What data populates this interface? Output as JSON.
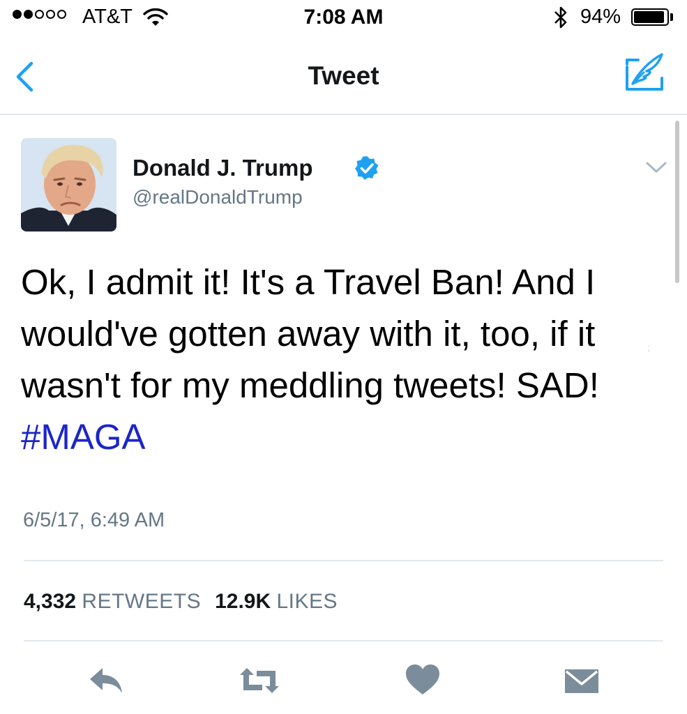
{
  "status_bar": {
    "carrier": "AT&T",
    "time": "7:08 AM",
    "battery_percent": "94%",
    "battery_level": 0.94,
    "signal_strength": 2,
    "signal_total": 5
  },
  "nav": {
    "title": "Tweet",
    "accent_color": "#1da1f2"
  },
  "tweet": {
    "author_name": "Donald J. Trump",
    "author_handle": "@realDonaldTrump",
    "verified": true,
    "text": "Ok, I admit it! It's a Travel Ban! And I would've gotten away with it, too, if it wasn't for my meddling tweets! SAD!",
    "hashtag": "#MAGA",
    "hashtag_color": "#1b25c9",
    "timestamp": "6/5/17, 6:49 AM",
    "retweets_count": "4,332",
    "retweets_label": "RETWEETS",
    "likes_count": "12.9K",
    "likes_label": "LIKES"
  },
  "icons": {
    "back": "chevron-left-icon",
    "compose": "compose-icon",
    "verified": "verified-badge-icon",
    "more": "chevron-down-icon",
    "reply": "reply-icon",
    "retweet": "retweet-icon",
    "like": "heart-icon",
    "message": "envelope-icon"
  }
}
